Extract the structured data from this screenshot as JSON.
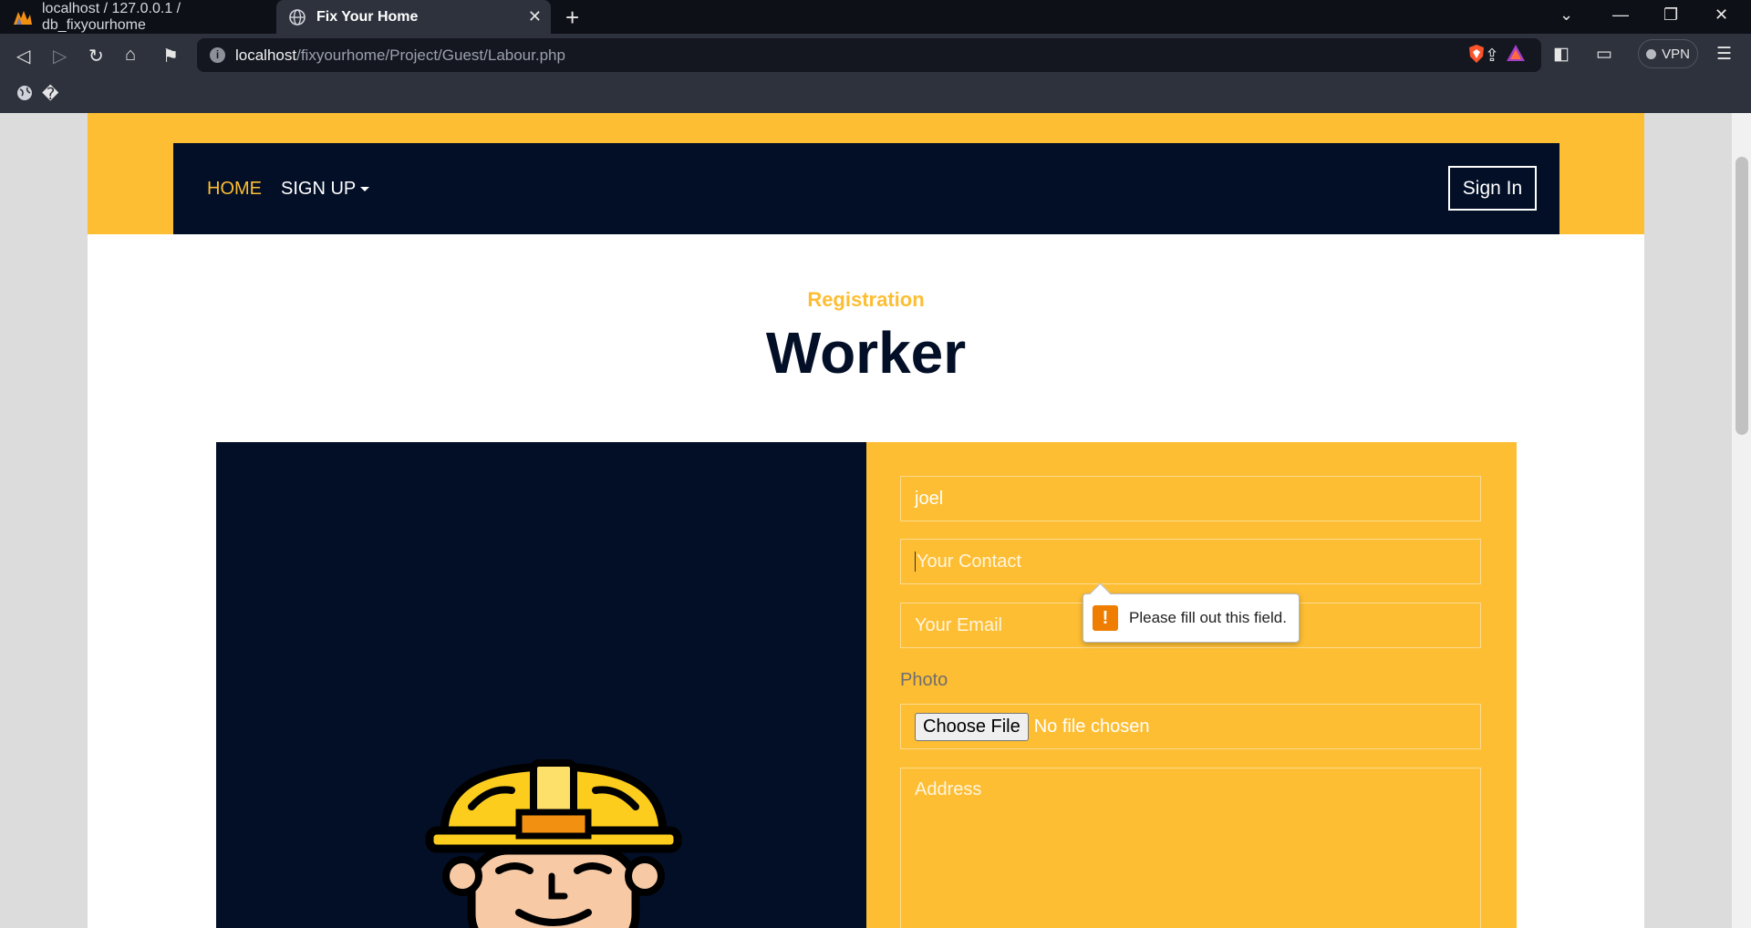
{
  "browser": {
    "tabs": [
      {
        "title": "localhost / 127.0.0.1 / db_fixyourhome",
        "active": false
      },
      {
        "title": "Fix Your Home",
        "active": true
      }
    ],
    "url_host": "localhost",
    "url_path": "/fixyourhome/Project/Guest/Labour.php",
    "vpn_label": "VPN",
    "bookmark_glyph": "�"
  },
  "nav": {
    "home_label": "HOME",
    "signup_label": "SIGN UP",
    "signin_label": "Sign In"
  },
  "header": {
    "subtitle": "Registration",
    "title": "Worker"
  },
  "form": {
    "name_value": "joel",
    "contact_placeholder": "Your Contact",
    "email_placeholder": "Your Email",
    "photo_label": "Photo",
    "choose_file_label": "Choose File",
    "no_file_label": "No file chosen",
    "address_placeholder": "Address"
  },
  "validation": {
    "message": "Please fill out this field."
  },
  "colors": {
    "accent": "#fdbe33",
    "navy": "#030f27",
    "warning": "#ee7d00"
  }
}
